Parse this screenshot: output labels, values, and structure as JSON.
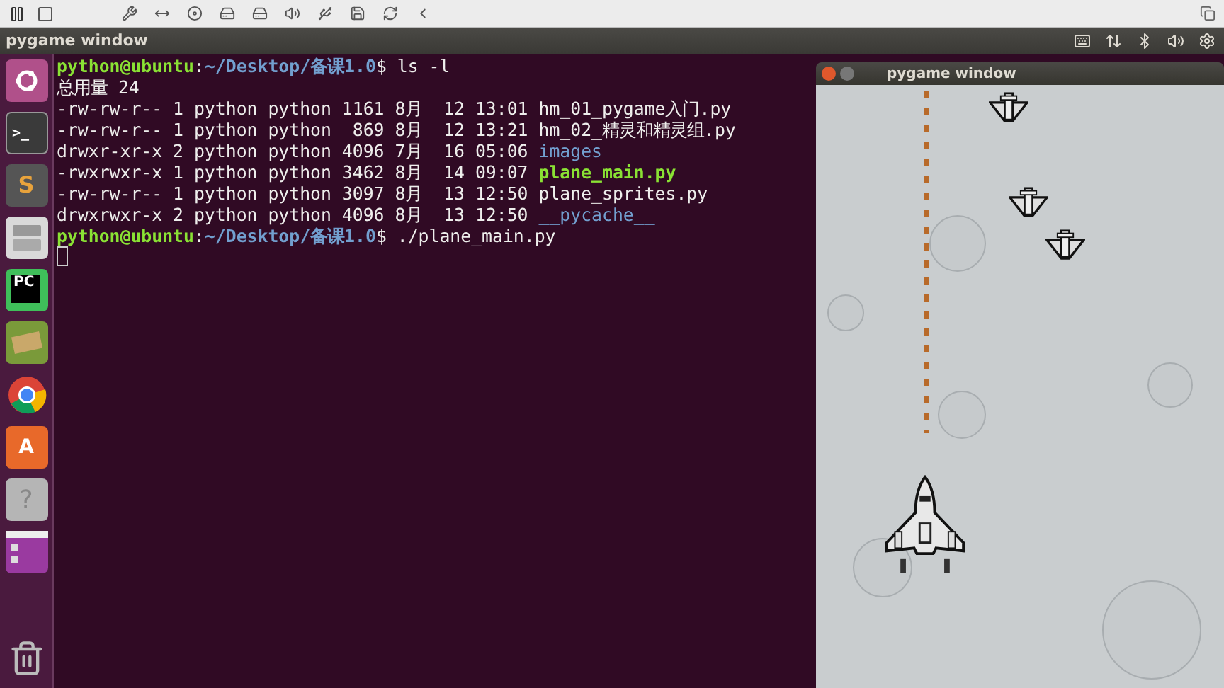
{
  "panel": {
    "title": "pygame window"
  },
  "launcher": [
    {
      "kind": "ubuntu"
    },
    {
      "kind": "terminal",
      "glyph": ">_"
    },
    {
      "kind": "sublime",
      "glyph": "S"
    },
    {
      "kind": "files"
    },
    {
      "kind": "pycharm",
      "glyph": "PC"
    },
    {
      "kind": "books"
    },
    {
      "kind": "chrome"
    },
    {
      "kind": "software",
      "glyph": "A"
    },
    {
      "kind": "help",
      "glyph": "?"
    },
    {
      "kind": "workspace"
    },
    {
      "kind": "trash"
    }
  ],
  "terminal": {
    "lines": [
      [
        {
          "text": "python@ubuntu",
          "kind": "user"
        },
        {
          "text": ":",
          "kind": "plain"
        },
        {
          "text": "~/Desktop/备课1.0",
          "kind": "path"
        },
        {
          "text": "$ ls -l",
          "kind": "plain"
        }
      ],
      [
        {
          "text": "总用量 24",
          "kind": "plain"
        }
      ],
      [
        {
          "text": "-rw-rw-r-- 1 python python 1161 8月  12 13:01 hm_01_pygame入门.py",
          "kind": "plain"
        }
      ],
      [
        {
          "text": "-rw-rw-r-- 1 python python  869 8月  12 13:21 hm_02_精灵和精灵组.py",
          "kind": "plain"
        }
      ],
      [
        {
          "text": "drwxr-xr-x 2 python python 4096 7月  16 05:06 ",
          "kind": "plain"
        },
        {
          "text": "images",
          "kind": "dir"
        }
      ],
      [
        {
          "text": "-rwxrwxr-x 1 python python 3462 8月  14 09:07 ",
          "kind": "plain"
        },
        {
          "text": "plane_main.py",
          "kind": "exec"
        }
      ],
      [
        {
          "text": "-rw-rw-r-- 1 python python 3097 8月  13 12:50 plane_sprites.py",
          "kind": "plain"
        }
      ],
      [
        {
          "text": "drwxrwxr-x 2 python python 4096 8月  13 12:50 ",
          "kind": "plain"
        },
        {
          "text": "__pycache__",
          "kind": "dir"
        }
      ],
      [
        {
          "text": "python@ubuntu",
          "kind": "user"
        },
        {
          "text": ":",
          "kind": "plain"
        },
        {
          "text": "~/Desktop/备课1.0",
          "kind": "path"
        },
        {
          "text": "$ ./plane_main.py",
          "kind": "plain"
        }
      ]
    ]
  },
  "game_window": {
    "title": "pygame window"
  }
}
